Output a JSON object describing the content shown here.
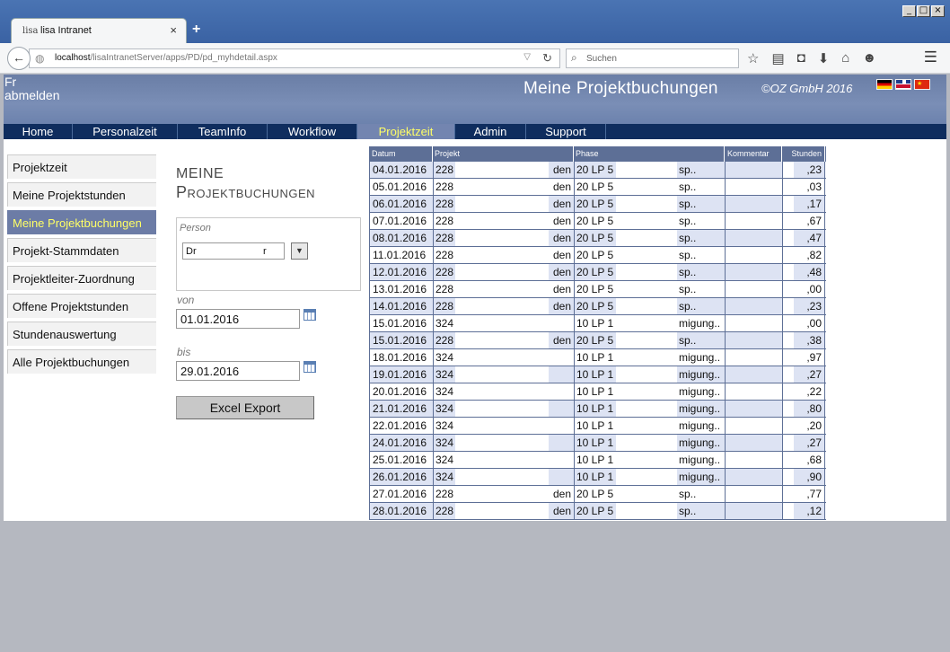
{
  "browser": {
    "tab_logo": "lisa",
    "tab_title": "lisa Intranet",
    "tab_close": "×",
    "new_tab": "+",
    "url_host": "localhost",
    "url_path": "/lisaIntranetServer/apps/PD/pd_myhdetail.aspx",
    "search_placeholder": "Suchen",
    "window_buttons": [
      "_",
      "□",
      "×"
    ]
  },
  "header": {
    "user_line1": "Fr",
    "user_line2": "abmelden",
    "title": "Meine Projektbuchungen",
    "copyright": "©OZ GmbH 2016"
  },
  "menu": [
    {
      "label": "Home",
      "active": false
    },
    {
      "label": "Personalzeit",
      "active": false
    },
    {
      "label": "TeamInfo",
      "active": false
    },
    {
      "label": "Workflow",
      "active": false
    },
    {
      "label": "Projektzeit",
      "active": true
    },
    {
      "label": "Admin",
      "active": false
    },
    {
      "label": "Support",
      "active": false
    }
  ],
  "sidenav": [
    {
      "label": "Projektzeit",
      "active": false
    },
    {
      "label": "Meine Projektstunden",
      "active": false
    },
    {
      "label": "Meine Projektbuchungen",
      "active": true
    },
    {
      "label": "Projekt-Stammdaten",
      "active": false
    },
    {
      "label": "Projektleiter-Zuordnung",
      "active": false
    },
    {
      "label": "Offene Projektstunden",
      "active": false
    },
    {
      "label": "Stundenauswertung",
      "active": false
    },
    {
      "label": "Alle Projektbuchungen",
      "active": false
    }
  ],
  "form": {
    "title_line1": "Meine",
    "title_line2": "Projektbuchungen",
    "person_label": "Person",
    "person_value": "Dr",
    "person_value_end": "r",
    "von_label": "von",
    "von_value": "01.01.2016",
    "bis_label": "bis",
    "bis_value": "29.01.2016",
    "export_label": "Excel Export"
  },
  "table": {
    "headers": [
      "Datum",
      "Projekt",
      "Phase",
      "Kommentar",
      "Stunden"
    ],
    "rows": [
      {
        "datum": "04.01.2016",
        "projekt": "228",
        "projekt_end": "den",
        "phase": "20 LP 5",
        "phase_end": "sp..",
        "kommentar": "",
        "stunden": ",23"
      },
      {
        "datum": "05.01.2016",
        "projekt": "228",
        "projekt_end": "den",
        "phase": "20 LP 5",
        "phase_end": "sp..",
        "kommentar": "",
        "stunden": ",03"
      },
      {
        "datum": "06.01.2016",
        "projekt": "228",
        "projekt_end": "den",
        "phase": "20 LP 5",
        "phase_end": "sp..",
        "kommentar": "",
        "stunden": ",17"
      },
      {
        "datum": "07.01.2016",
        "projekt": "228",
        "projekt_end": "den",
        "phase": "20 LP 5",
        "phase_end": "sp..",
        "kommentar": "",
        "stunden": ",67"
      },
      {
        "datum": "08.01.2016",
        "projekt": "228",
        "projekt_end": "den",
        "phase": "20 LP 5",
        "phase_end": "sp..",
        "kommentar": "",
        "stunden": ",47"
      },
      {
        "datum": "11.01.2016",
        "projekt": "228",
        "projekt_end": "den",
        "phase": "20 LP 5",
        "phase_end": "sp..",
        "kommentar": "",
        "stunden": ",82"
      },
      {
        "datum": "12.01.2016",
        "projekt": "228",
        "projekt_end": "den",
        "phase": "20 LP 5",
        "phase_end": "sp..",
        "kommentar": "",
        "stunden": ",48"
      },
      {
        "datum": "13.01.2016",
        "projekt": "228",
        "projekt_end": "den",
        "phase": "20 LP 5",
        "phase_end": "sp..",
        "kommentar": "",
        "stunden": ",00"
      },
      {
        "datum": "14.01.2016",
        "projekt": "228",
        "projekt_end": "den",
        "phase": "20 LP 5",
        "phase_end": "sp..",
        "kommentar": "",
        "stunden": ",23"
      },
      {
        "datum": "15.01.2016",
        "projekt": "324",
        "projekt_end": "",
        "phase": "10 LP 1",
        "phase_end": "migung..",
        "kommentar": "",
        "stunden": ",00"
      },
      {
        "datum": "15.01.2016",
        "projekt": "228",
        "projekt_end": "den",
        "phase": "20 LP 5",
        "phase_end": "sp..",
        "kommentar": "",
        "stunden": ",38"
      },
      {
        "datum": "18.01.2016",
        "projekt": "324",
        "projekt_end": "",
        "phase": "10 LP 1",
        "phase_end": "migung..",
        "kommentar": "",
        "stunden": ",97"
      },
      {
        "datum": "19.01.2016",
        "projekt": "324",
        "projekt_end": "",
        "phase": "10 LP 1",
        "phase_end": "migung..",
        "kommentar": "",
        "stunden": ",27"
      },
      {
        "datum": "20.01.2016",
        "projekt": "324",
        "projekt_end": "",
        "phase": "10 LP 1",
        "phase_end": "migung..",
        "kommentar": "",
        "stunden": ",22"
      },
      {
        "datum": "21.01.2016",
        "projekt": "324",
        "projekt_end": "",
        "phase": "10 LP 1",
        "phase_end": "migung..",
        "kommentar": "",
        "stunden": ",80"
      },
      {
        "datum": "22.01.2016",
        "projekt": "324",
        "projekt_end": "",
        "phase": "10 LP 1",
        "phase_end": "migung..",
        "kommentar": "",
        "stunden": ",20"
      },
      {
        "datum": "24.01.2016",
        "projekt": "324",
        "projekt_end": "",
        "phase": "10 LP 1",
        "phase_end": "migung..",
        "kommentar": "",
        "stunden": ",27"
      },
      {
        "datum": "25.01.2016",
        "projekt": "324",
        "projekt_end": "",
        "phase": "10 LP 1",
        "phase_end": "migung..",
        "kommentar": "",
        "stunden": ",68"
      },
      {
        "datum": "26.01.2016",
        "projekt": "324",
        "projekt_end": "",
        "phase": "10 LP 1",
        "phase_end": "migung..",
        "kommentar": "",
        "stunden": ",90"
      },
      {
        "datum": "27.01.2016",
        "projekt": "228",
        "projekt_end": "den",
        "phase": "20 LP 5",
        "phase_end": "sp..",
        "kommentar": "",
        "stunden": ",77"
      },
      {
        "datum": "28.01.2016",
        "projekt": "228",
        "projekt_end": "den",
        "phase": "20 LP 5",
        "phase_end": "sp..",
        "kommentar": "",
        "stunden": ",12"
      }
    ]
  },
  "colors": {
    "header_bg": "#6c82ad",
    "menu_bg": "#0f2d5e",
    "active_text": "#ffff66",
    "table_header_bg": "#5d6f96",
    "row_alt_bg": "#dde3f3"
  }
}
